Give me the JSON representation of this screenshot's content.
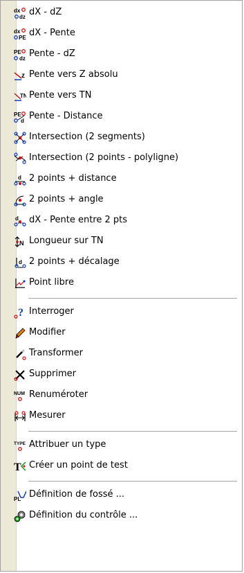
{
  "menu": {
    "items": [
      {
        "label": "dX - dZ",
        "icon": "dx-dz-icon"
      },
      {
        "label": "dX - Pente",
        "icon": "dx-pente-icon"
      },
      {
        "label": "Pente - dZ",
        "icon": "pente-dz-icon"
      },
      {
        "label": "Pente vers Z absolu",
        "icon": "slope-to-z-icon"
      },
      {
        "label": "Pente vers TN",
        "icon": "slope-to-tn-icon"
      },
      {
        "label": "Pente - Distance",
        "icon": "pente-distance-icon"
      },
      {
        "label": "Intersection (2 segments)",
        "icon": "intersection-segments-icon"
      },
      {
        "label": "Intersection (2 points - polyligne)",
        "icon": "intersection-polyline-icon"
      },
      {
        "label": "2 points + distance",
        "icon": "two-points-distance-icon"
      },
      {
        "label": "2 points + angle",
        "icon": "two-points-angle-icon"
      },
      {
        "label": "dX - Pente entre 2 pts",
        "icon": "dx-slope-between-points-icon"
      },
      {
        "label": "Longueur sur TN",
        "icon": "length-on-tn-icon"
      },
      {
        "label": "2 points + décalage",
        "icon": "two-points-offset-icon"
      },
      {
        "label": "Point libre",
        "icon": "free-point-icon"
      },
      {
        "label": "Interroger",
        "icon": "query-icon"
      },
      {
        "label": "Modifier",
        "icon": "pencil-icon"
      },
      {
        "label": "Transformer",
        "icon": "transform-wand-icon"
      },
      {
        "label": "Supprimer",
        "icon": "delete-cross-icon"
      },
      {
        "label": "Renuméroter",
        "icon": "renumber-icon"
      },
      {
        "label": "Mesurer",
        "icon": "measure-icon"
      },
      {
        "label": "Attribuer un type",
        "icon": "assign-type-icon"
      },
      {
        "label": "Créer un point de test",
        "icon": "test-point-icon"
      },
      {
        "label": "Définition de fossé ...",
        "icon": "ditch-definition-icon"
      },
      {
        "label": "Définition du contrôle ...",
        "icon": "control-definition-icon"
      }
    ],
    "icon_texts": {
      "dx_dz_top": "dx",
      "dx_dz_bottom": "dz",
      "pe": "PE",
      "z": "z",
      "tn": "TN",
      "d": "d",
      "num": "NUM",
      "type": "TYPE",
      "t": "T",
      "pl": "PL"
    },
    "colors": {
      "icon_red": "#d01010",
      "icon_blue": "#1040c0",
      "icon_green": "#10a010",
      "icon_orange": "#e08000",
      "separator": "#a5a5a5"
    }
  }
}
